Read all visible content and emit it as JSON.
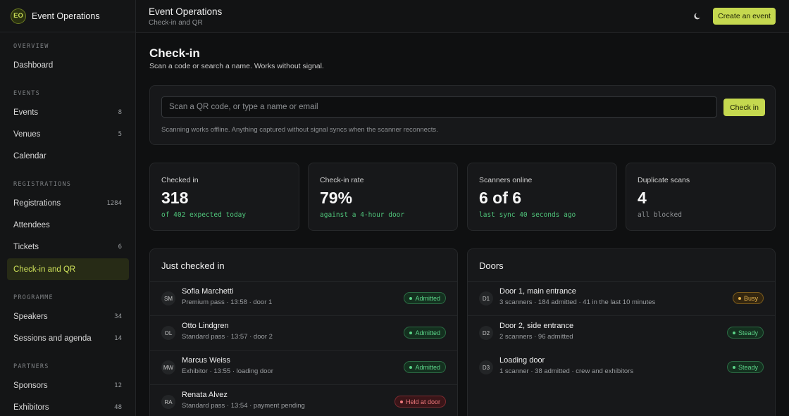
{
  "brand": {
    "initials": "EO",
    "name": "Event Operations"
  },
  "sidebar": {
    "sections": [
      {
        "label": "OVERVIEW"
      },
      {
        "label": "EVENTS"
      },
      {
        "label": "REGISTRATIONS"
      },
      {
        "label": "PROGRAMME"
      },
      {
        "label": "PARTNERS"
      }
    ],
    "items": [
      {
        "label": "Dashboard",
        "count": ""
      },
      {
        "label": "Events",
        "count": "8"
      },
      {
        "label": "Venues",
        "count": "5"
      },
      {
        "label": "Calendar",
        "count": ""
      },
      {
        "label": "Registrations",
        "count": "1284"
      },
      {
        "label": "Attendees",
        "count": ""
      },
      {
        "label": "Tickets",
        "count": "6"
      },
      {
        "label": "Check-in and QR",
        "count": "",
        "active": true
      },
      {
        "label": "Speakers",
        "count": "34"
      },
      {
        "label": "Sessions and agenda",
        "count": "14"
      },
      {
        "label": "Sponsors",
        "count": "12"
      },
      {
        "label": "Exhibitors",
        "count": "48"
      }
    ]
  },
  "topbar": {
    "title": "Event Operations",
    "subtitle": "Check-in and QR",
    "theme_icon": "moon-icon",
    "create_label": "Create an event"
  },
  "page": {
    "title": "Check-in",
    "subtitle": "Scan a code or search a name. Works without signal."
  },
  "scan": {
    "placeholder": "Scan a QR code, or type a name or email",
    "button_label": "Check in",
    "note": "Scanning works offline. Anything captured without signal syncs when the scanner reconnects."
  },
  "stats": [
    {
      "label": "Checked in",
      "value": "318",
      "sub": "of 402 expected today",
      "sub_color": "green"
    },
    {
      "label": "Check-in rate",
      "value": "79%",
      "sub": "against a 4-hour door",
      "sub_color": "green"
    },
    {
      "label": "Scanners online",
      "value": "6 of 6",
      "sub": "last sync 40 seconds ago",
      "sub_color": "green"
    },
    {
      "label": "Duplicate scans",
      "value": "4",
      "sub": "all blocked",
      "sub_color": "muted"
    }
  ],
  "recent": {
    "title": "Just checked in",
    "rows": [
      {
        "initials": "SM",
        "name": "Sofia Marchetti",
        "detail": "Premium pass · 13:58 · door 1",
        "status": "Admitted",
        "tone": "green"
      },
      {
        "initials": "OL",
        "name": "Otto Lindgren",
        "detail": "Standard pass · 13:57 · door 2",
        "status": "Admitted",
        "tone": "green"
      },
      {
        "initials": "MW",
        "name": "Marcus Weiss",
        "detail": "Exhibitor · 13:55 · loading door",
        "status": "Admitted",
        "tone": "green"
      },
      {
        "initials": "RA",
        "name": "Renata Alvez",
        "detail": "Standard pass · 13:54 · payment pending",
        "status": "Held at door",
        "tone": "red"
      }
    ]
  },
  "doors": {
    "title": "Doors",
    "rows": [
      {
        "initials": "D1",
        "name": "Door 1, main entrance",
        "detail": "3 scanners · 184 admitted · 41 in the last 10 minutes",
        "status": "Busy",
        "tone": "amber"
      },
      {
        "initials": "D2",
        "name": "Door 2, side entrance",
        "detail": "2 scanners · 96 admitted",
        "status": "Steady",
        "tone": "green"
      },
      {
        "initials": "D3",
        "name": "Loading door",
        "detail": "1 scanner · 38 admitted · crew and exhibitors",
        "status": "Steady",
        "tone": "green"
      }
    ]
  }
}
